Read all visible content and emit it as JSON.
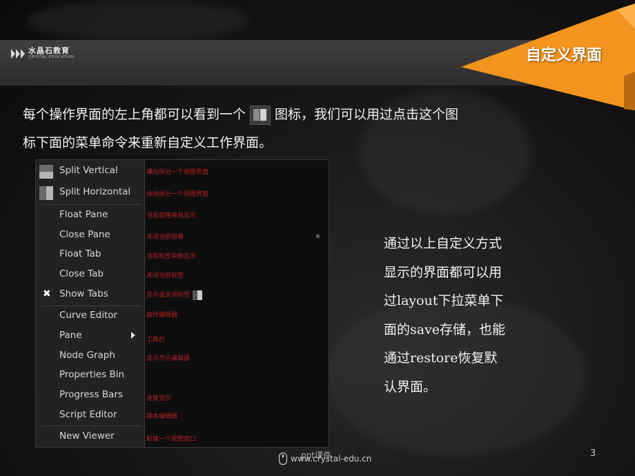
{
  "brand": {
    "name_cn": "水晶石教育",
    "name_en": "CRYSTAL EDUCATION"
  },
  "slide": {
    "title": "自定义界面",
    "page_number": "3"
  },
  "intro": {
    "line1_before_icon": "每个操作界面的左上角都可以看到一个",
    "line1_after_icon": "图标，我们可以用过点击这个图",
    "line2": "标下面的菜单命令来重新自定义工作界面。"
  },
  "menu": {
    "items": [
      {
        "label": "Split Vertical",
        "icon": "split-vertical-icon",
        "annotation": "横向拆分一个视图界面"
      },
      {
        "label": "Split Horizontal",
        "icon": "split-horizontal-icon",
        "annotation": "纵向拆分一个视图界面"
      },
      {
        "label": "Float Pane",
        "annotation": "当前窗格单独显示"
      },
      {
        "label": "Close Pane",
        "annotation": "关闭当前窗格"
      },
      {
        "label": "Float Tab",
        "annotation": "当前标签单独显示"
      },
      {
        "label": "Close Tab",
        "annotation": "关闭当前标签"
      },
      {
        "label": "Show Tabs",
        "checked": true,
        "annotation": "显示或关闭标签"
      },
      {
        "label": "Curve Editor",
        "annotation": "曲线编辑器"
      },
      {
        "label": "Pane",
        "submenu": true,
        "annotation": "工具栏"
      },
      {
        "label": "Node Graph",
        "annotation": "显示节点编辑器"
      },
      {
        "label": "Properties Bin",
        "annotation": ""
      },
      {
        "label": "Progress Bars",
        "annotation": "进度显示"
      },
      {
        "label": "Script Editor",
        "annotation": "脚本编辑器"
      },
      {
        "label": "New Viewer",
        "annotation": "新建一个视图窗口"
      }
    ]
  },
  "side_text": {
    "lines": [
      "通过以上自定义方式",
      "显示的界面都可以用",
      "过layout下拉菜单下",
      "面的save存储，也能",
      "通过restore恢复默",
      "认界面。"
    ]
  },
  "footer": {
    "watermark": "ppt课件",
    "url": "www.crystal-edu.cn"
  },
  "colors": {
    "accent_orange": "#f2941e",
    "annotation_red": "#b32020"
  }
}
